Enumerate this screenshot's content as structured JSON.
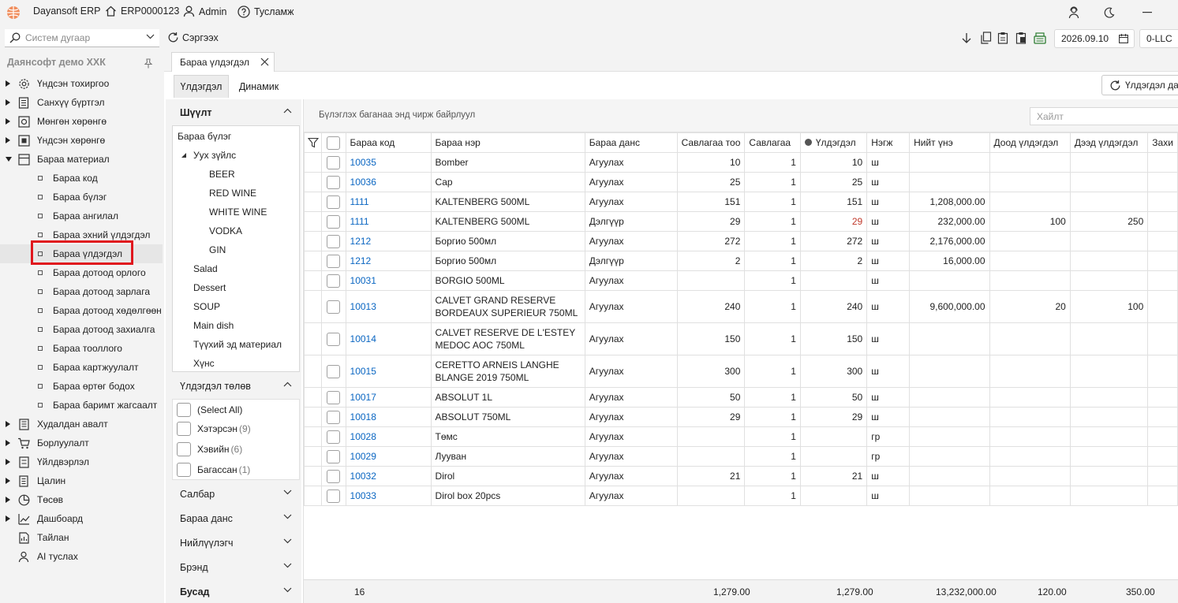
{
  "titlebar": {
    "app_name": "Dayansoft ERP",
    "home_label": "ERP0000123",
    "user_label": "Admin",
    "help_label": "Тусламж"
  },
  "toolbar": {
    "search_placeholder": "Систем дугаар",
    "refresh_label": "Сэргээх",
    "date": "2026.09.10",
    "company_code": "0-LLC"
  },
  "nav": {
    "company": "Даянсофт демо ХХК",
    "items": [
      {
        "label": "Үндсэн тохиргоо",
        "icon": "gear-icon"
      },
      {
        "label": "Санхүү бүртгэл",
        "icon": "ledger-icon"
      },
      {
        "label": "Мөнгөн хөрөнгө",
        "icon": "cash-icon"
      },
      {
        "label": "Үндсэн хөрөнгө",
        "icon": "asset-icon"
      },
      {
        "label": "Бараа материал",
        "icon": "inventory-icon"
      }
    ],
    "sub_items": [
      "Бараа код",
      "Бараа бүлэг",
      "Бараа ангилал",
      "Бараа эхний үлдэгдэл",
      "Бараа үлдэгдэл",
      "Бараа дотоод орлого",
      "Бараа дотоод зарлага",
      "Бараа дотоод хөдөлгөөн",
      "Бараа дотоод захиалга",
      "Бараа тооллого",
      "Бараа картжуулалт",
      "Бараа өртөг бодох",
      "Бараа баримт жагсаалт"
    ],
    "items_after": [
      {
        "label": "Худалдан авалт",
        "icon": "purchase-icon"
      },
      {
        "label": "Борлуулалт",
        "icon": "cart-icon"
      },
      {
        "label": "Үйлдвэрлэл",
        "icon": "factory-icon"
      },
      {
        "label": "Цалин",
        "icon": "payroll-icon"
      },
      {
        "label": "Төсөв",
        "icon": "pie-chart-icon"
      },
      {
        "label": "Дашбоард",
        "icon": "dashboard-icon"
      },
      {
        "label": "Тайлан",
        "icon": "report-icon"
      },
      {
        "label": "AI туслах",
        "icon": "ai-assistant-icon"
      }
    ]
  },
  "tabs": {
    "document": "Бараа үлдэгдэл",
    "sub": [
      "Үлдэгдэл",
      "Динамик"
    ],
    "refresh_balance": "Үлдэгдэл дах"
  },
  "filter": {
    "section_filter": "Шүүлт",
    "tree": [
      "Бараа бүлэг",
      "Уух зүйлс",
      "BEER",
      "RED WINE",
      "WHITE WINE",
      "VODKA",
      "GIN",
      "Salad",
      "Dessert",
      "SOUP",
      "Main dish",
      "Түүхий эд материал",
      "Хүнс"
    ],
    "status_title": "Үлдэгдэл төлөв",
    "status": [
      {
        "label": "(Select All)",
        "count": ""
      },
      {
        "label": "Хэтэрсэн",
        "count": "(9)"
      },
      {
        "label": "Хэвийн",
        "count": "(6)"
      },
      {
        "label": "Багассан",
        "count": "(1)"
      }
    ],
    "collapsed": [
      "Салбар",
      "Бараа данс",
      "Нийлүүлэгч",
      "Брэнд",
      "Бусад"
    ]
  },
  "grid": {
    "group_hint": "Бүлэглэх баганаа энд чирж байрлуул",
    "search_placeholder": "Хайлт",
    "columns": [
      "Бараа код",
      "Бараа нэр",
      "Бараа данс",
      "Савлагаа тоо",
      "Савлагаа",
      "Үлдэгдэл",
      "Нэгж",
      "Нийт үнэ",
      "Доод үлдэгдэл",
      "Дээд үлдэгдэл",
      "Захи"
    ],
    "rows": [
      {
        "code": "10035",
        "name": "Bomber",
        "account": "Агуулах",
        "pack_qty": "10",
        "pack": "1",
        "balance": "10",
        "unit": "ш",
        "total": "",
        "min": "",
        "max": ""
      },
      {
        "code": "10036",
        "name": "Cap",
        "account": "Агуулах",
        "pack_qty": "25",
        "pack": "1",
        "balance": "25",
        "unit": "ш",
        "total": "",
        "min": "",
        "max": ""
      },
      {
        "code": "1111",
        "name": "KALTENBERG 500ML",
        "account": "Агуулах",
        "pack_qty": "151",
        "pack": "1",
        "balance": "151",
        "unit": "ш",
        "total": "1,208,000.00",
        "min": "",
        "max": ""
      },
      {
        "code": "1111",
        "name": "KALTENBERG 500ML",
        "account": "Дэлгүүр",
        "pack_qty": "29",
        "pack": "1",
        "balance": "29",
        "unit": "ш",
        "total": "232,000.00",
        "min": "100",
        "max": "250",
        "low": true
      },
      {
        "code": "1212",
        "name": "Боргио 500мл",
        "account": "Агуулах",
        "pack_qty": "272",
        "pack": "1",
        "balance": "272",
        "unit": "ш",
        "total": "2,176,000.00",
        "min": "",
        "max": ""
      },
      {
        "code": "1212",
        "name": "Боргио 500мл",
        "account": "Дэлгүүр",
        "pack_qty": "2",
        "pack": "1",
        "balance": "2",
        "unit": "ш",
        "total": "16,000.00",
        "min": "",
        "max": ""
      },
      {
        "code": "10031",
        "name": "BORGIO 500ML",
        "account": "Агуулах",
        "pack_qty": "",
        "pack": "1",
        "balance": "",
        "unit": "ш",
        "total": "",
        "min": "",
        "max": ""
      },
      {
        "code": "10013",
        "name": "CALVET GRAND RESERVE BORDEAUX SUPERIEUR 750ML",
        "account": "Агуулах",
        "pack_qty": "240",
        "pack": "1",
        "balance": "240",
        "unit": "ш",
        "total": "9,600,000.00",
        "min": "20",
        "max": "100",
        "tall": true
      },
      {
        "code": "10014",
        "name": "CALVET RESERVE DE L'ESTEY MEDOC AOC 750ML",
        "account": "Агуулах",
        "pack_qty": "150",
        "pack": "1",
        "balance": "150",
        "unit": "ш",
        "total": "",
        "min": "",
        "max": "",
        "tall": true
      },
      {
        "code": "10015",
        "name": "CERETTO ARNEIS LANGHE BLANGE 2019 750ML",
        "account": "Агуулах",
        "pack_qty": "300",
        "pack": "1",
        "balance": "300",
        "unit": "ш",
        "total": "",
        "min": "",
        "max": "",
        "tall": true
      },
      {
        "code": "10017",
        "name": "ABSOLUT 1L",
        "account": "Агуулах",
        "pack_qty": "50",
        "pack": "1",
        "balance": "50",
        "unit": "ш",
        "total": "",
        "min": "",
        "max": ""
      },
      {
        "code": "10018",
        "name": "ABSOLUT 750ML",
        "account": "Агуулах",
        "pack_qty": "29",
        "pack": "1",
        "balance": "29",
        "unit": "ш",
        "total": "",
        "min": "",
        "max": ""
      },
      {
        "code": "10028",
        "name": "Төмс",
        "account": "Агуулах",
        "pack_qty": "",
        "pack": "1",
        "balance": "",
        "unit": "гр",
        "total": "",
        "min": "",
        "max": ""
      },
      {
        "code": "10029",
        "name": "Лууван",
        "account": "Агуулах",
        "pack_qty": "",
        "pack": "1",
        "balance": "",
        "unit": "гр",
        "total": "",
        "min": "",
        "max": ""
      },
      {
        "code": "10032",
        "name": "Dirol",
        "account": "Агуулах",
        "pack_qty": "21",
        "pack": "1",
        "balance": "21",
        "unit": "ш",
        "total": "",
        "min": "",
        "max": ""
      },
      {
        "code": "10033",
        "name": "Dirol box 20pcs",
        "account": "Агуулах",
        "pack_qty": "",
        "pack": "1",
        "balance": "",
        "unit": "ш",
        "total": "",
        "min": "",
        "max": ""
      }
    ],
    "footer": {
      "count": "16",
      "pack_qty": "1,279.00",
      "balance": "1,279.00",
      "total": "13,232,000.00",
      "min": "120.00",
      "max": "350.00"
    },
    "colors": {
      "link": "#0a66c2",
      "low_stock": "#c0392b",
      "selection_highlight": "#e0171e"
    }
  }
}
